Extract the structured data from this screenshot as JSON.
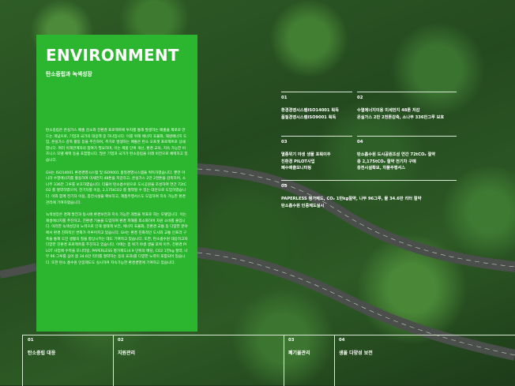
{
  "panel": {
    "title": "ENVIRONMENT",
    "subtitle": "탄소중립과 녹색성장",
    "paragraphs": [
      "탄소중립은 온실가스 배출 감소와 친환경 프로젝트에 투자를 통해 발생하는 배출을 제로로 만드는 개념으로, 기업과 국가의 대응책 중 하나입니다. 이를 위해 에너지 효율화, 재생에너지 도입, 온실가스 감축 활동 등을 추진하며, 추가로 발생하는 배출은 탄소 오프셋 프로젝트로 상쇄합니다. 여러 이해관계자의 참여가 필요하며, 이는 제품 단위 개선, 환경 교육, 지속 가능한 비즈니스 모델 채택 등을 포함합니다. 많은 기업과 국가가 탄소중립을 미래 비전으로 채택하고 있습니다.",
      "GH는 ISO14001 환경경영시스템 및 ISO9001 품질경영시스템을 획득하였습니다. 뿐만 아니라 수열에너지를 활용하여 미세먼지 48톤을 저감하고, 온실가스 2만 2천톤을 감축하며, 소나무 336만 그루를 보호하였습니다. 더불어 탄소흡수원으로 도시공원을 조성하여 연간 72tCO2 를 절약하였으며, 전기차를 이용, 2,175tCO2 를 절약할 수 있는 대안으로 도입하였습니다. 이와 함께 전기차 이용, 충전시설을 확보하고, 제품주행서스도 도입하여 지속 가능한 환경 관리에 기여하였습니다.",
      "녹색성장은 경제 발전과 동시에 환경보전과 지속 가능한 개발을 목표로 하는 모델입니다. 이는 재생에너지를 추진하고, 친환경 기술을 도입하여 환경 피해를 최소화하며 자원 소비를 줄입니다. 이러한 녹색성장의 노력으로 인해 생태계 보전, 에너지 효율화, 친환경 교통 등 다양한 분야에서 환경 친화적인 변화가 이루어지고 있습니다. GH는 환경 친화적인 도시와 교통 인프라 구축을 통해 도민 생활의 질을 향상시키는 데도 기여하고 있습니다. 또한, 탄소흡수원 대응하고자 다양한 친환경 프로젝트를 추진하고 있습니다. 이에는 총 위기 야생 생물 포획 이주, 친환경 PILOT 사업에 수목을 모니터링, PAPERLESS 평가제도(4.9 단위의 배당, CO2 1만kg 절약, 나무 96 그루를 심어 봄 34.6만 리터를 절약하는 등의 효과)를 다양한 노력이 포함되어 있습니다. 또한 탄소 흡수원 인증제도도 실시하며 지속가능한 환경경영에 기여하고 있습니다."
    ]
  },
  "items": [
    {
      "num": "01",
      "lines": [
        "환경경영시스템ISO14001 획득",
        "품질경영시스템ISO9001 획득"
      ]
    },
    {
      "num": "02",
      "lines": [
        "수열에너지이용 미세먼지 48톤 저감",
        "온실가스 2만 2천톤감축, 소나무 336만그루 보호"
      ]
    },
    {
      "num": "03",
      "lines": [
        "멸종위기 야생 생물 포획이주",
        "친환경 PILOT사업",
        "폐수배출모니터링"
      ]
    },
    {
      "num": "04",
      "lines": [
        "탄소흡수원 도시공원조성 연간 72tCO₂ 절약",
        "총 2,175tCO₂ 절약 전기차 구매",
        "충전시설확보, 차풀주행서스"
      ]
    },
    {
      "num": "05",
      "lines": [
        "PAPERLESS 평가제도, CO₂ 1만kg절약, 나무 96그루, 물 34.6만 리터 절약",
        "탄소흡수원 인증제도실시"
      ]
    }
  ],
  "bottom": [
    {
      "num": "01",
      "label": "탄소중립 대응"
    },
    {
      "num": "02",
      "label": "지원관리"
    },
    {
      "num": "03",
      "label": "폐기물관리"
    },
    {
      "num": "04",
      "label": "생물 다양성 보전"
    }
  ]
}
